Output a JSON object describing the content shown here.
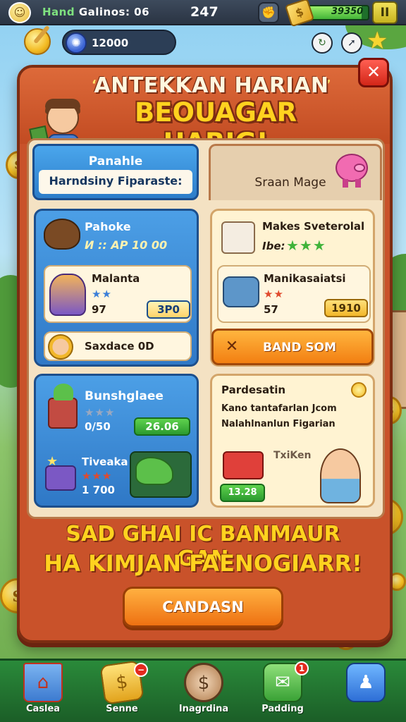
{
  "topbar": {
    "player_name_prefix": "Hand",
    "player_name_rest": "Galinos: 06",
    "clock": "247",
    "gold_value": "39350",
    "gold_fill_fraction": 0.9,
    "pause_label": "II",
    "avatar_icon": "coin-face-icon",
    "fist_icon": "fist-icon",
    "gold_icon": "gold-bar-icon"
  },
  "resources": {
    "gem_value": "12000",
    "gem_icon": "gem-icon",
    "wand_icon": "wand-icon",
    "round_icons": [
      "refresh-icon",
      "arrow-icon"
    ],
    "star_icon": "star-icon"
  },
  "panel": {
    "title_line1": "ANTEKKAN HARIAN",
    "title_line2": "BEOUAGAR HARIG!",
    "close_label": "✕"
  },
  "tabs": {
    "left_line1": "Panahle",
    "left_line2": "Harndsiny Fiparaste:",
    "right_label": "Sraan Mage"
  },
  "cards": {
    "card1": {
      "title": "Pahoke",
      "subtitle": "И :: AP 10 00",
      "item_name": "Malanta",
      "item_count": "97",
      "item_price": "3P0",
      "footer_text": "Saxdace 0D"
    },
    "card2": {
      "title": "Makes Sveterolal",
      "subtitle": "Ibe:",
      "item_name": "Manikasaiatsi",
      "item_count": "57",
      "item_price": "1910",
      "button_label": "BAND SOM"
    },
    "card3": {
      "title": "Bunshglaee",
      "count1": "0/50",
      "price1": "26.06",
      "item_name": "Tiveaka",
      "count2": "1 700"
    },
    "card4": {
      "title": "Pardesatin",
      "line1": "Kano tantafarlan Jcom",
      "line2": "Nalahlnanlun Figarian",
      "item_name": "TxiKen",
      "price": "13.28"
    }
  },
  "promo": {
    "line1": "SAD GHAI IC BANMAUR GAN",
    "line2": "HA KIMJAN FAENOGIARR!",
    "button_label": "CANDASN"
  },
  "nav": {
    "items": [
      {
        "label": "Caslea",
        "icon": "house-icon"
      },
      {
        "label": "Senne",
        "icon": "coin-bag-icon"
      },
      {
        "label": "Inagrdina",
        "icon": "dollar-coin-icon"
      },
      {
        "label": "Padding",
        "icon": "mail-icon",
        "badge": "1"
      },
      {
        "label": "",
        "icon": "puzzle-icon"
      }
    ]
  }
}
